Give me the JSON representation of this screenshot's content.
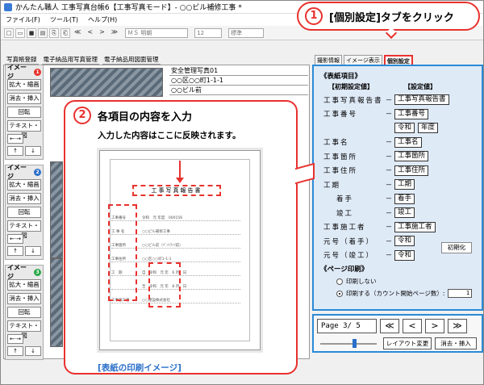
{
  "window": {
    "title": "かんたん職人 工事写真台帳6【工事写真モード】- ○○ビル補修工事 *"
  },
  "menu": [
    "ファイル(F)",
    "ツール(T)",
    "ヘルプ(H)"
  ],
  "toolbar": {
    "font": "ＭＳ 明朝",
    "size": "12",
    "style": "標準"
  },
  "left_tabs": [
    "写真帳登録",
    "電子納品用写真管理",
    "電子納品用図面管理"
  ],
  "tool_groups": [
    {
      "badge": "1",
      "color": "#e8312e",
      "buttons": [
        "拡大・縮画",
        "消去・挿入",
        "回転",
        "テキスト・図"
      ]
    },
    {
      "badge": "2",
      "color": "#2a6fc9",
      "buttons": [
        "拡大・縮画",
        "消去・挿入",
        "回転",
        "テキスト・図"
      ]
    },
    {
      "badge": "3",
      "color": "#2aa84a",
      "buttons": [
        "拡大・縮画",
        "消去・挿入",
        "回転",
        "テキスト・図"
      ]
    }
  ],
  "tool_group_label": "イメージ",
  "sheet_header": [
    "安全管理写真01",
    "○○区○○町1-1-1",
    "○○ビル前"
  ],
  "right_tabs": [
    "撮影情報",
    "イメージ表示",
    "個別設定"
  ],
  "settings": {
    "cover_title": "《表紙項目》",
    "initial_header": "【初期設定値】",
    "value_header": "【設定値】",
    "rows": [
      {
        "label": "工事写真報告書",
        "values": [
          "工事写真報告書"
        ]
      },
      {
        "label": "工事番号",
        "values": [
          "工事番号"
        ]
      },
      {
        "label": "",
        "values": [
          "令和",
          "年度"
        ]
      },
      {
        "label": "工事名",
        "values": [
          "工事名"
        ]
      },
      {
        "label": "工事箇所",
        "values": [
          "工事箇所"
        ]
      },
      {
        "label": "工事住所",
        "values": [
          "工事住所"
        ]
      },
      {
        "label": "工期",
        "values": [
          "工期"
        ]
      },
      {
        "label": "着手",
        "values": [
          "着手"
        ]
      },
      {
        "label": "竣工",
        "values": [
          "竣工"
        ]
      },
      {
        "label": "工事施工者",
        "values": [
          "工事施工者"
        ]
      },
      {
        "label": "元号（着手）",
        "values": [
          "令和"
        ]
      },
      {
        "label": "元号（竣工）",
        "values": [
          "令和"
        ]
      }
    ],
    "dash": "－",
    "reset_button": "初期化",
    "page_print_title": "《ページ印刷》",
    "no_print": "印刷しない",
    "print": "印刷する（カウント開始ページ数）:",
    "start_page": "1"
  },
  "navigator": {
    "page_label": "Page 3/ 5",
    "buttons": [
      "≪",
      "<",
      ">",
      "≫"
    ],
    "layout_button": "レイアウト変更",
    "erase_button": "消去・挿入"
  },
  "callout1": {
    "number": "1",
    "text": "[個別設定]タブをクリック"
  },
  "callout2": {
    "number": "2",
    "title": "各項目の内容を入力",
    "subtitle": "入力した内容はここに反映されます。"
  },
  "preview": {
    "title": "工事写真報告書",
    "lines": [
      [
        "工事番号",
        "令和　元 年度　000156"
      ],
      [
        "工 事 名",
        "○○ビル補修工事"
      ],
      [
        "工事箇所",
        "○○ビル前（ﾍﾟﾝﾄﾗﾝﾂ前）"
      ],
      [
        "工事住所",
        "○○区○○町1-1-1"
      ],
      [
        "工　期",
        "自　令和　元 年　6 月　日"
      ],
      [
        "",
        "至　令和　元 年　8 月　日"
      ],
      [
        "工事施工者",
        "○○建設株式会社"
      ]
    ],
    "caption": "[表紙の印刷イメージ]"
  }
}
